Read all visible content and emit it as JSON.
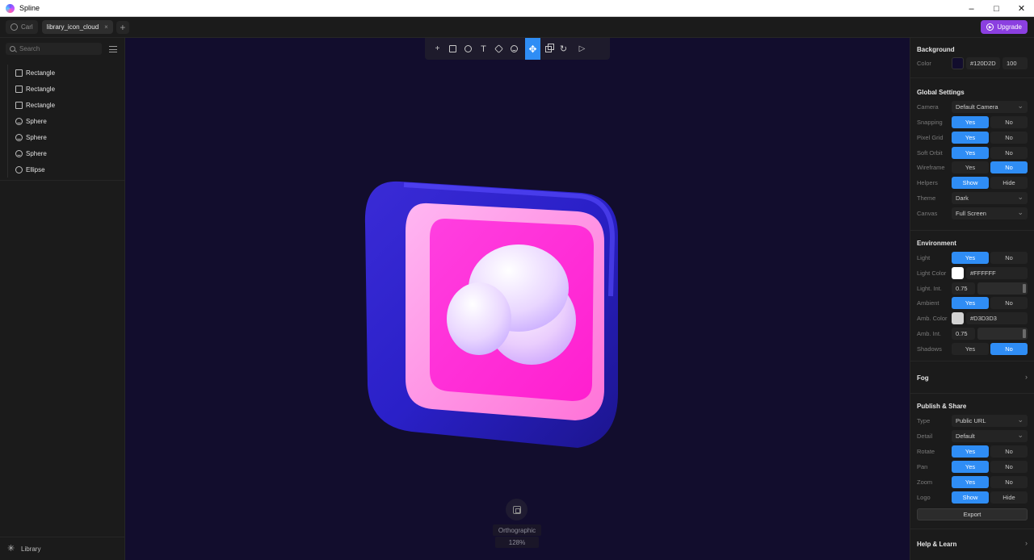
{
  "window": {
    "title": "Spline"
  },
  "tabs": {
    "user": "Carl",
    "file": "library_icon_cloud",
    "close": "×",
    "add": "+",
    "upgrade": "Upgrade"
  },
  "left": {
    "search_placeholder": "Search",
    "layers": [
      {
        "name": "Rectangle",
        "icon": "rectangle-icon"
      },
      {
        "name": "Rectangle",
        "icon": "rectangle-icon"
      },
      {
        "name": "Rectangle",
        "icon": "rectangle-icon"
      },
      {
        "name": "Sphere",
        "icon": "sphere-icon"
      },
      {
        "name": "Sphere",
        "icon": "sphere-icon"
      },
      {
        "name": "Sphere",
        "icon": "sphere-icon"
      },
      {
        "name": "Ellipse",
        "icon": "ellipse-icon"
      }
    ],
    "library": "Library"
  },
  "canvas": {
    "background": "#120D2D",
    "view_mode": "Orthographic",
    "zoom": "128%"
  },
  "right": {
    "background": {
      "title": "Background",
      "color_label": "Color",
      "color_value": "#120D2D",
      "opacity": "100"
    },
    "global": {
      "title": "Global Settings",
      "camera_label": "Camera",
      "camera_value": "Default Camera",
      "snapping_label": "Snapping",
      "pixelgrid_label": "Pixel Grid",
      "softorbit_label": "Soft Orbit",
      "wireframe_label": "Wireframe",
      "helpers_label": "Helpers",
      "theme_label": "Theme",
      "theme_value": "Dark",
      "canvas_label": "Canvas",
      "canvas_value": "Full Screen"
    },
    "environment": {
      "title": "Environment",
      "light_label": "Light",
      "lightcolor_label": "Light Color",
      "lightcolor_value": "#FFFFFF",
      "lightint_label": "Light. Int.",
      "lightint_value": "0.75",
      "ambient_label": "Ambient",
      "ambcolor_label": "Amb. Color",
      "ambcolor_value": "#D3D3D3",
      "ambint_label": "Amb. Int.",
      "ambint_value": "0.75",
      "shadows_label": "Shadows"
    },
    "fog": {
      "title": "Fog"
    },
    "publish": {
      "title": "Publish & Share",
      "type_label": "Type",
      "type_value": "Public URL",
      "detail_label": "Detail",
      "detail_value": "Default",
      "rotate_label": "Rotate",
      "pan_label": "Pan",
      "zoom_label": "Zoom",
      "logo_label": "Logo",
      "export": "Export"
    },
    "help": {
      "title": "Help & Learn"
    },
    "yes": "Yes",
    "no": "No",
    "show": "Show",
    "hide": "Hide"
  },
  "colors": {
    "accent": "#2F8DF5",
    "upgrade": "#8B3FE0",
    "light_color": "#FFFFFF",
    "amb_color": "#D3D3D3"
  }
}
